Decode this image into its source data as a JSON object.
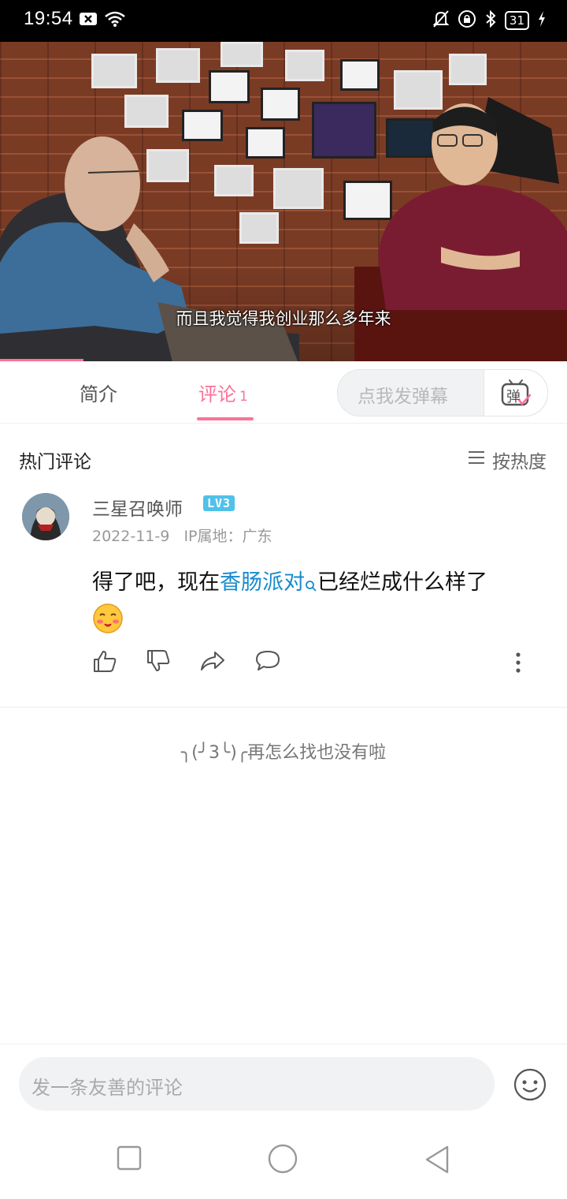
{
  "status_bar": {
    "time": "19:54",
    "battery": "31",
    "icons": [
      "x-notification-icon",
      "wifi-icon",
      "mute-bell-icon",
      "lock-rotation-icon",
      "bluetooth-icon",
      "battery-icon",
      "charging-icon"
    ]
  },
  "video": {
    "subtitle": "而且我觉得我创业那么多年来",
    "progress_fraction": 0.147
  },
  "tabs": {
    "intro_label": "简介",
    "comments_label": "评论",
    "comments_count": "1",
    "active": "comments",
    "danmaku_placeholder": "点我发弹幕",
    "danmaku_icon_char": "弹"
  },
  "comments": {
    "section_title": "热门评论",
    "sort_label": "按热度",
    "items": [
      {
        "username": "三星召唤师",
        "level": "LV3",
        "date": "2022-11-9",
        "ip_location": "IP属地：广东",
        "text_before": "得了吧，现在",
        "link_text": "香肠派对",
        "text_after": "已经烂成什么样了",
        "emoji": "blush-emoji"
      }
    ],
    "end_text": "╮(╯3╰)╭再怎么找也没有啦"
  },
  "bottom": {
    "input_placeholder": "发一条友善的评论"
  },
  "colors": {
    "accent": "#fb7299",
    "link": "#178bcf",
    "level_badge": "#50c1e9"
  }
}
